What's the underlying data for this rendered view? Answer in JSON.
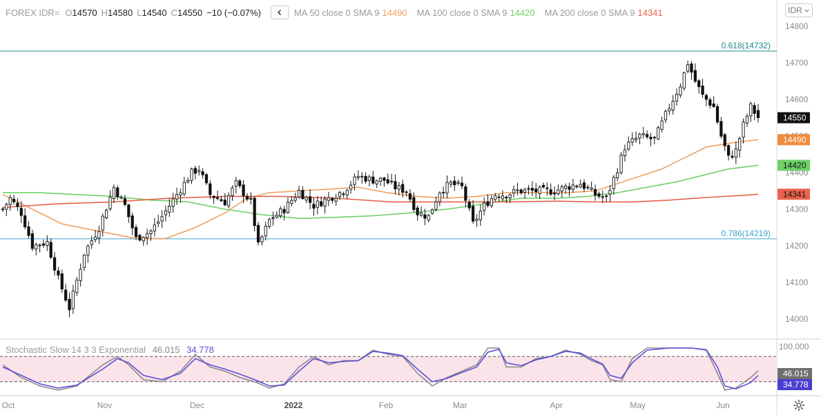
{
  "header": {
    "symbol": "FOREX IDR=",
    "open_label": "O",
    "open": "14570",
    "high_label": "H",
    "high": "14580",
    "low_label": "L",
    "low": "14540",
    "close_label": "C",
    "close": "14550",
    "change": "−10 (−0.07%)",
    "collapse_icon": "chevron-left-icon"
  },
  "moving_averages": [
    {
      "label": "MA 50 close 0 SMA 9",
      "value": "14490",
      "color": "#f0a060"
    },
    {
      "label": "MA 100 close 0 SMA 9",
      "value": "14420",
      "color": "#6fd168"
    },
    {
      "label": "MA 200 close 0 SMA 9",
      "value": "14341",
      "color": "#e8634a"
    }
  ],
  "currency_selector": {
    "value": "IDR",
    "icon": "chevron-down-icon"
  },
  "fib_levels": [
    {
      "label": "0.618(14732)",
      "value": 14732,
      "color": "#1c8a8a"
    },
    {
      "label": "0.786(14219)",
      "value": 14219,
      "color": "#3aa0d0"
    }
  ],
  "price_badges": [
    {
      "value": "14550",
      "bg": "#111111",
      "fg": "#ffffff"
    },
    {
      "value": "14490",
      "bg": "#f08a3c",
      "fg": "#ffffff"
    },
    {
      "value": "14420",
      "bg": "#6fd168",
      "fg": "#111111"
    },
    {
      "value": "14341",
      "bg": "#e8634a",
      "fg": "#111111"
    }
  ],
  "stochastic": {
    "name": "Stochastic Slow 14 3 3 Exponential",
    "k_value": "46.015",
    "k_color": "#8a8a8a",
    "d_value": "34.778",
    "d_color": "#5a4fd6",
    "axis_label": "100.000",
    "upper": 80,
    "lower": 20,
    "band_color": "#fbe3ea"
  },
  "settings_icon": "gear-icon",
  "chart_data": {
    "type": "candlestick",
    "title": "FOREX IDR=",
    "y_axis": {
      "min": 13950,
      "max": 14820,
      "ticks": [
        "14800",
        "14700",
        "14600",
        "14500",
        "14400",
        "14300",
        "14200",
        "14100",
        "14000"
      ],
      "tick_values": [
        14800,
        14700,
        14600,
        14500,
        14400,
        14300,
        14200,
        14100,
        14000
      ],
      "position": "right"
    },
    "x_axis": {
      "labels": [
        "Oct",
        "Nov",
        "Dec",
        "2022",
        "Feb",
        "Mar",
        "Apr",
        "May",
        "Jun"
      ],
      "label_index": [
        0,
        26,
        51,
        77,
        102,
        122,
        148,
        170,
        193
      ]
    },
    "count": 205,
    "anchors": [
      [
        0,
        14300
      ],
      [
        2,
        14330
      ],
      [
        5,
        14290
      ],
      [
        8,
        14200
      ],
      [
        12,
        14210
      ],
      [
        15,
        14110
      ],
      [
        18,
        14030
      ],
      [
        22,
        14180
      ],
      [
        26,
        14250
      ],
      [
        30,
        14360
      ],
      [
        33,
        14310
      ],
      [
        36,
        14220
      ],
      [
        40,
        14240
      ],
      [
        43,
        14280
      ],
      [
        47,
        14340
      ],
      [
        51,
        14400
      ],
      [
        53,
        14410
      ],
      [
        56,
        14340
      ],
      [
        60,
        14320
      ],
      [
        63,
        14370
      ],
      [
        67,
        14320
      ],
      [
        69,
        14200
      ],
      [
        72,
        14270
      ],
      [
        76,
        14300
      ],
      [
        80,
        14350
      ],
      [
        84,
        14310
      ],
      [
        88,
        14330
      ],
      [
        92,
        14350
      ],
      [
        96,
        14390
      ],
      [
        100,
        14380
      ],
      [
        103,
        14380
      ],
      [
        106,
        14360
      ],
      [
        109,
        14350
      ],
      [
        112,
        14290
      ],
      [
        115,
        14280
      ],
      [
        118,
        14350
      ],
      [
        121,
        14370
      ],
      [
        124,
        14360
      ],
      [
        127,
        14260
      ],
      [
        130,
        14310
      ],
      [
        133,
        14340
      ],
      [
        136,
        14340
      ],
      [
        139,
        14350
      ],
      [
        142,
        14350
      ],
      [
        145,
        14350
      ],
      [
        149,
        14350
      ],
      [
        152,
        14360
      ],
      [
        156,
        14370
      ],
      [
        160,
        14340
      ],
      [
        163,
        14330
      ],
      [
        166,
        14410
      ],
      [
        168,
        14470
      ],
      [
        172,
        14500
      ],
      [
        176,
        14490
      ],
      [
        180,
        14580
      ],
      [
        183,
        14640
      ],
      [
        185,
        14700
      ],
      [
        187,
        14650
      ],
      [
        189,
        14610
      ],
      [
        192,
        14580
      ],
      [
        194,
        14500
      ],
      [
        196,
        14440
      ],
      [
        198,
        14460
      ],
      [
        200,
        14530
      ],
      [
        202,
        14580
      ],
      [
        204,
        14550
      ]
    ],
    "series": [
      {
        "name": "MA 50 close 0 SMA 9",
        "color": "#f0a060",
        "points": [
          [
            0,
            14340
          ],
          [
            8,
            14300
          ],
          [
            16,
            14260
          ],
          [
            26,
            14240
          ],
          [
            36,
            14220
          ],
          [
            44,
            14220
          ],
          [
            52,
            14250
          ],
          [
            60,
            14290
          ],
          [
            66,
            14330
          ],
          [
            72,
            14345
          ],
          [
            80,
            14350
          ],
          [
            88,
            14355
          ],
          [
            96,
            14360
          ],
          [
            104,
            14345
          ],
          [
            112,
            14335
          ],
          [
            120,
            14330
          ],
          [
            128,
            14335
          ],
          [
            136,
            14345
          ],
          [
            144,
            14345
          ],
          [
            152,
            14345
          ],
          [
            160,
            14350
          ],
          [
            166,
            14370
          ],
          [
            172,
            14390
          ],
          [
            178,
            14410
          ],
          [
            184,
            14440
          ],
          [
            190,
            14470
          ],
          [
            196,
            14480
          ],
          [
            204,
            14490
          ]
        ]
      },
      {
        "name": "MA 100 close 0 SMA 9",
        "color": "#6fd168",
        "points": [
          [
            0,
            14345
          ],
          [
            10,
            14345
          ],
          [
            20,
            14340
          ],
          [
            30,
            14335
          ],
          [
            40,
            14325
          ],
          [
            50,
            14320
          ],
          [
            60,
            14300
          ],
          [
            70,
            14285
          ],
          [
            80,
            14275
          ],
          [
            90,
            14278
          ],
          [
            100,
            14282
          ],
          [
            110,
            14290
          ],
          [
            120,
            14300
          ],
          [
            130,
            14315
          ],
          [
            140,
            14330
          ],
          [
            150,
            14330
          ],
          [
            158,
            14335
          ],
          [
            166,
            14345
          ],
          [
            174,
            14360
          ],
          [
            182,
            14375
          ],
          [
            190,
            14395
          ],
          [
            196,
            14410
          ],
          [
            204,
            14420
          ]
        ]
      },
      {
        "name": "MA 200 close 0 SMA 9",
        "color": "#e8634a",
        "points": [
          [
            0,
            14305
          ],
          [
            15,
            14315
          ],
          [
            30,
            14320
          ],
          [
            45,
            14330
          ],
          [
            60,
            14335
          ],
          [
            75,
            14335
          ],
          [
            90,
            14330
          ],
          [
            105,
            14320
          ],
          [
            120,
            14320
          ],
          [
            135,
            14320
          ],
          [
            150,
            14322
          ],
          [
            160,
            14320
          ],
          [
            170,
            14320
          ],
          [
            180,
            14325
          ],
          [
            190,
            14332
          ],
          [
            200,
            14338
          ],
          [
            204,
            14341
          ]
        ]
      }
    ],
    "stochastic": {
      "k_points": [
        [
          0,
          60
        ],
        [
          5,
          30
        ],
        [
          10,
          10
        ],
        [
          15,
          0
        ],
        [
          20,
          10
        ],
        [
          27,
          60
        ],
        [
          31,
          80
        ],
        [
          34,
          60
        ],
        [
          38,
          25
        ],
        [
          43,
          20
        ],
        [
          48,
          45
        ],
        [
          52,
          85
        ],
        [
          56,
          55
        ],
        [
          60,
          45
        ],
        [
          64,
          30
        ],
        [
          68,
          20
        ],
        [
          72,
          5
        ],
        [
          76,
          15
        ],
        [
          80,
          55
        ],
        [
          84,
          80
        ],
        [
          88,
          60
        ],
        [
          92,
          70
        ],
        [
          96,
          70
        ],
        [
          100,
          95
        ],
        [
          104,
          85
        ],
        [
          108,
          80
        ],
        [
          112,
          40
        ],
        [
          116,
          10
        ],
        [
          120,
          30
        ],
        [
          124,
          45
        ],
        [
          128,
          60
        ],
        [
          131,
          100
        ],
        [
          134,
          100
        ],
        [
          136,
          55
        ],
        [
          140,
          55
        ],
        [
          144,
          75
        ],
        [
          148,
          80
        ],
        [
          152,
          95
        ],
        [
          156,
          85
        ],
        [
          159,
          70
        ],
        [
          162,
          60
        ],
        [
          164,
          25
        ],
        [
          167,
          20
        ],
        [
          170,
          75
        ],
        [
          174,
          100
        ],
        [
          180,
          100
        ],
        [
          186,
          100
        ],
        [
          190,
          95
        ],
        [
          193,
          40
        ],
        [
          195,
          0
        ],
        [
          198,
          5
        ],
        [
          202,
          30
        ],
        [
          204,
          46
        ]
      ],
      "d_points": [
        [
          0,
          55
        ],
        [
          5,
          35
        ],
        [
          10,
          15
        ],
        [
          15,
          5
        ],
        [
          20,
          12
        ],
        [
          27,
          50
        ],
        [
          31,
          75
        ],
        [
          34,
          65
        ],
        [
          38,
          35
        ],
        [
          43,
          25
        ],
        [
          48,
          40
        ],
        [
          52,
          75
        ],
        [
          56,
          60
        ],
        [
          60,
          50
        ],
        [
          64,
          38
        ],
        [
          68,
          25
        ],
        [
          72,
          10
        ],
        [
          76,
          12
        ],
        [
          80,
          45
        ],
        [
          84,
          75
        ],
        [
          88,
          65
        ],
        [
          92,
          68
        ],
        [
          96,
          70
        ],
        [
          100,
          92
        ],
        [
          104,
          88
        ],
        [
          108,
          82
        ],
        [
          112,
          50
        ],
        [
          116,
          20
        ],
        [
          120,
          28
        ],
        [
          124,
          42
        ],
        [
          128,
          55
        ],
        [
          131,
          90
        ],
        [
          134,
          97
        ],
        [
          136,
          65
        ],
        [
          140,
          58
        ],
        [
          144,
          72
        ],
        [
          148,
          80
        ],
        [
          152,
          92
        ],
        [
          156,
          88
        ],
        [
          159,
          74
        ],
        [
          162,
          62
        ],
        [
          164,
          35
        ],
        [
          167,
          28
        ],
        [
          170,
          65
        ],
        [
          174,
          95
        ],
        [
          180,
          100
        ],
        [
          186,
          100
        ],
        [
          190,
          96
        ],
        [
          193,
          55
        ],
        [
          195,
          10
        ],
        [
          198,
          3
        ],
        [
          202,
          18
        ],
        [
          204,
          35
        ]
      ]
    }
  }
}
